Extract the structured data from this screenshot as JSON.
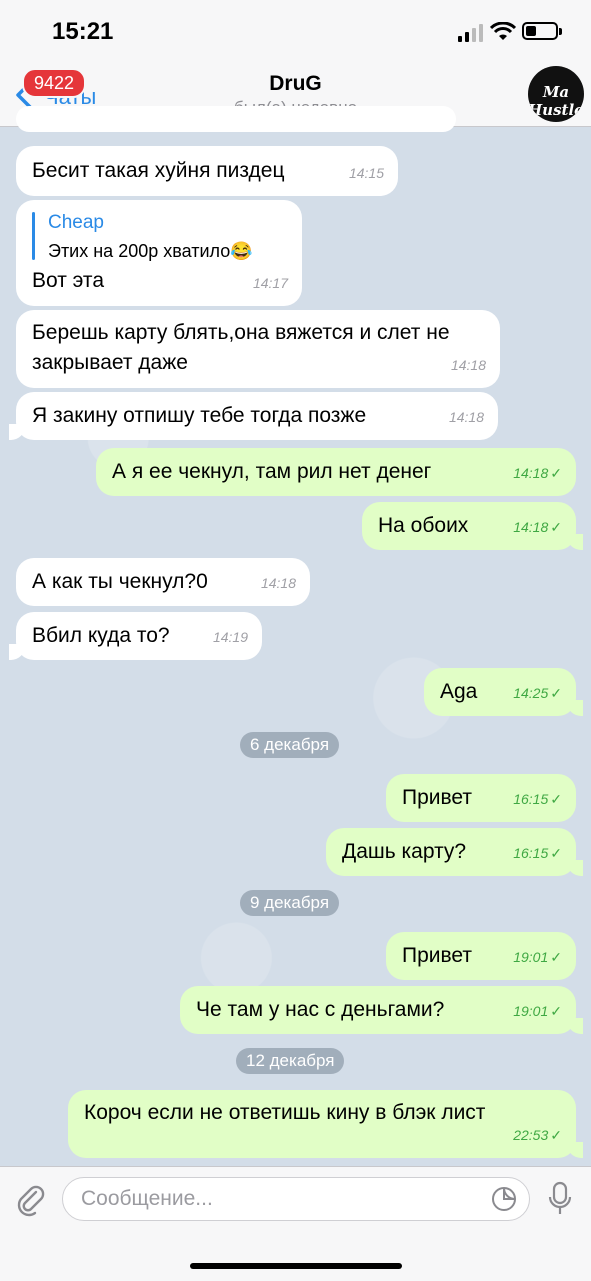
{
  "status": {
    "time": "15:21"
  },
  "nav": {
    "back_label": "Чаты",
    "badge": "9422",
    "title": "DruG",
    "subtitle": "был(а) недавно",
    "avatar_text": "Ma Hustler"
  },
  "messages": [
    {
      "dir": "in",
      "text": "Бесит такая хуйня пиздец",
      "time": "14:15"
    },
    {
      "dir": "in",
      "reply_name": "Cheap",
      "reply_text": "Этих на 200р хватило😂",
      "text": "Вот эта",
      "time": "14:17"
    },
    {
      "dir": "in",
      "text": "Берешь карту блять,она вяжется и слет не закрывает даже",
      "time": "14:18"
    },
    {
      "dir": "in",
      "text": "Я закину отпишу тебе тогда позже",
      "time": "14:18"
    },
    {
      "dir": "out",
      "text": "А я ее чекнул, там рил нет денег",
      "time": "14:18"
    },
    {
      "dir": "out",
      "text": "На обоих",
      "time": "14:18"
    },
    {
      "dir": "in",
      "text": "А как ты чекнул?0",
      "time": "14:18"
    },
    {
      "dir": "in",
      "text": "Вбил куда то?",
      "time": "14:19"
    },
    {
      "dir": "out",
      "text": "Aga",
      "time": "14:25"
    },
    {
      "dir": "out",
      "text": "Привет",
      "time": "16:15"
    },
    {
      "dir": "out",
      "text": "Дашь карту?",
      "time": "16:15"
    },
    {
      "dir": "out",
      "text": "Привет",
      "time": "19:01"
    },
    {
      "dir": "out",
      "text": "Че там у нас с деньгами?",
      "time": "19:01"
    },
    {
      "dir": "out",
      "text": "Короч если не ответишь кину в блэк лист",
      "time": "22:53"
    }
  ],
  "dates": [
    "6 декабря",
    "9 декабря",
    "12 декабря"
  ],
  "composer": {
    "placeholder": "Сообщение..."
  },
  "colors": {
    "accent": "#2a8ae6",
    "outgoing": "#e1fec6",
    "badge": "#e5363a"
  }
}
